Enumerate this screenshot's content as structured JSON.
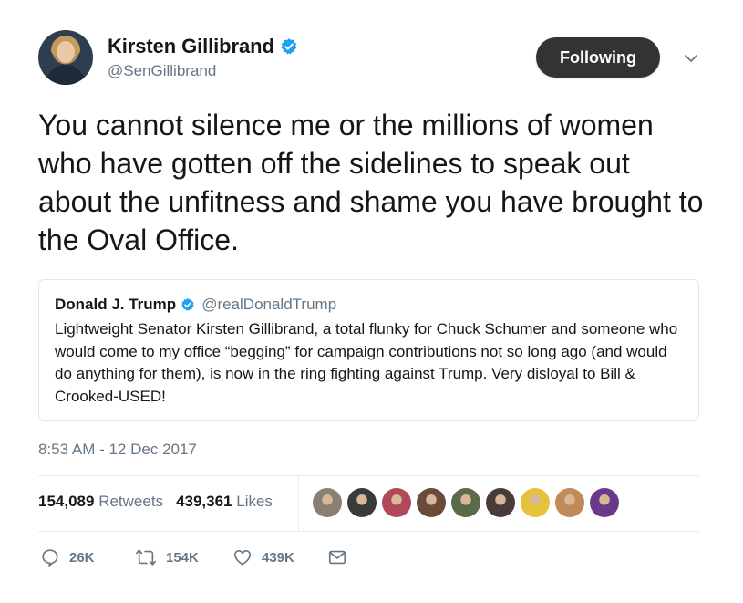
{
  "author": {
    "name": "Kirsten Gillibrand",
    "handle": "@SenGillibrand",
    "verified": true
  },
  "follow_button": {
    "label": "Following"
  },
  "tweet": {
    "text": "You cannot silence me or the millions of women who have gotten off the sidelines to speak out about the unfitness and shame you have brought to the Oval Office.",
    "timestamp": "8:53 AM - 12 Dec 2017"
  },
  "quoted_tweet": {
    "name": "Donald J. Trump",
    "handle": "@realDonaldTrump",
    "verified": true,
    "text": "Lightweight Senator Kirsten Gillibrand, a total flunky for Chuck Schumer and someone who would come to my office “begging” for campaign contributions not so long ago (and would do anything for them), is now in the ring fighting against Trump. Very disloyal to Bill & Crooked-USED!"
  },
  "stats": {
    "retweets_count": "154,089",
    "retweets_label": "Retweets",
    "likes_count": "439,361",
    "likes_label": "Likes"
  },
  "liker_avatars": [
    "#8a7f72",
    "#3a3a3a",
    "#b04a5a",
    "#6b4a3a",
    "#5a6b4a",
    "#4a3a3a",
    "#e6c23a",
    "#c08a5a",
    "#6a3a8a"
  ],
  "actions": {
    "reply_count": "26K",
    "retweet_count": "154K",
    "like_count": "439K"
  },
  "colors": {
    "accent": "#1da1f2",
    "text": "#14171a",
    "muted": "#657786",
    "button_bg": "#333333"
  },
  "icons": [
    "chevron-down-icon",
    "verified-badge-icon",
    "reply-icon",
    "retweet-icon",
    "like-icon",
    "message-icon"
  ]
}
